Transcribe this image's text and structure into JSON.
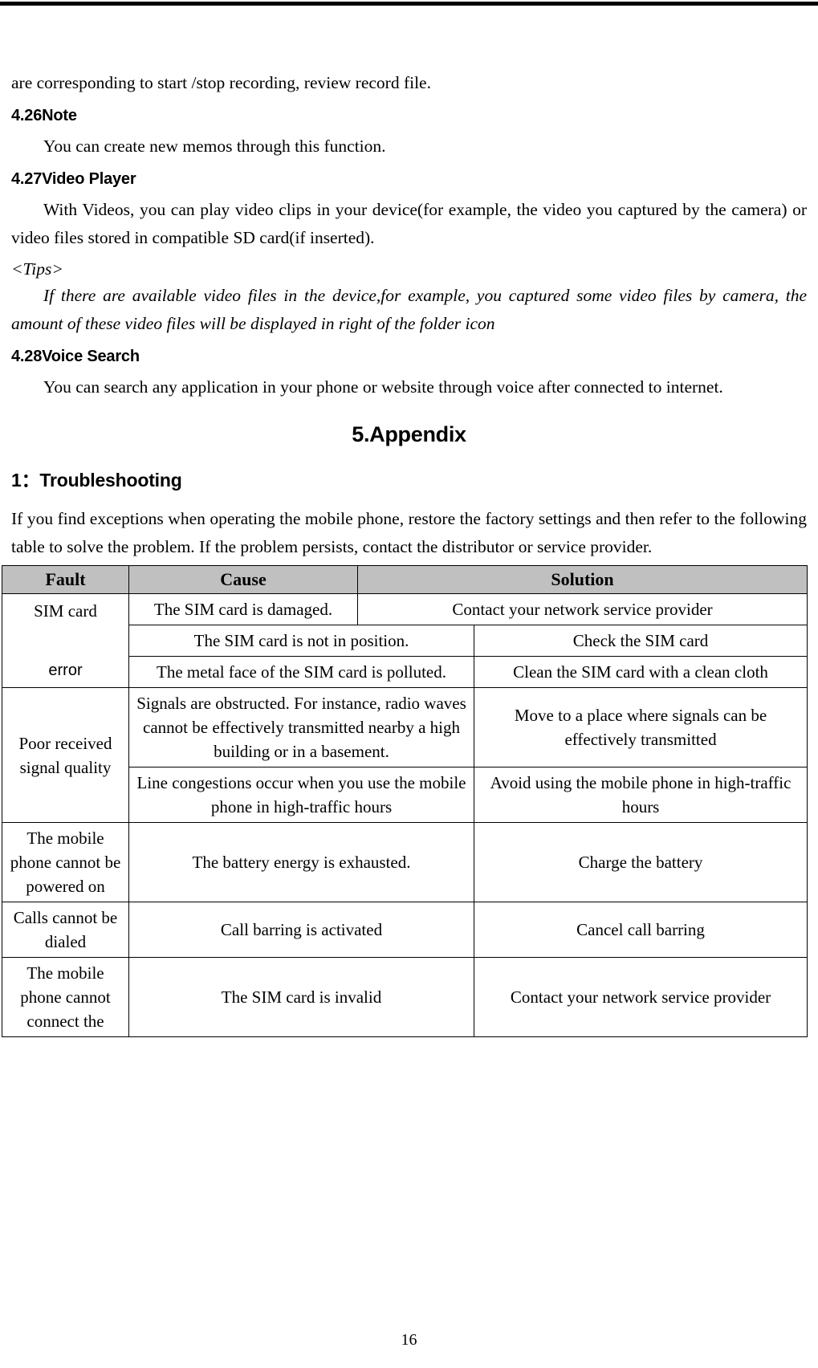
{
  "document": {
    "page_number": "16",
    "header_rule": true
  },
  "intro": {
    "continuation_line": "are corresponding to start /stop recording, review record file."
  },
  "sections": [
    {
      "heading": "4.26Note",
      "paragraphs": [
        "You can create new memos through this function."
      ]
    },
    {
      "heading": "4.27Video Player",
      "paragraphs": [
        "With Videos, you can play video clips in your device(for example, the video you captured by the camera) or video files stored in compatible SD card(if inserted)."
      ],
      "tips_label": "<Tips>",
      "tips_text": "If there are available video files in the device,for example, you captured some video files by camera, the amount of these video files will be displayed in right of the folder icon"
    },
    {
      "heading": "4.28Voice Search",
      "paragraphs": [
        "You can search any application in your phone or website through voice after connected to internet."
      ]
    }
  ],
  "appendix": {
    "chapter_title": "5.Appendix",
    "section_title": "1：Troubleshooting",
    "intro": "If you find exceptions when operating the mobile phone, restore the factory settings and then refer to the following table to solve the problem. If the problem persists, contact the distributor or service provider."
  },
  "table": {
    "header_bg": "#c0c0c0",
    "columns": [
      "Fault",
      "Cause",
      "Solution"
    ],
    "rows": [
      {
        "fault_primary": "SIM card",
        "fault_secondary": "error",
        "causes": [
          "The SIM card is damaged.",
          "The SIM card is not in position.",
          "The metal face of the SIM card is polluted."
        ],
        "solutions": [
          "Contact your network service provider",
          "Check the SIM card",
          "Clean the SIM card with a clean cloth"
        ]
      },
      {
        "fault": "Poor received signal quality",
        "causes": [
          "Signals are obstructed. For instance, radio waves cannot be effectively transmitted nearby a high building or in a basement.",
          "Line congestions occur when you use the mobile phone in high-traffic hours"
        ],
        "solutions": [
          "Move to a place where signals can be effectively transmitted",
          "Avoid using the mobile phone in high-traffic hours"
        ]
      },
      {
        "fault": "The mobile phone cannot be powered on",
        "causes": [
          "The battery energy is exhausted."
        ],
        "solutions": [
          "Charge the battery"
        ]
      },
      {
        "fault": "Calls cannot be dialed",
        "causes": [
          "Call barring is activated"
        ],
        "solutions": [
          "Cancel call barring"
        ]
      },
      {
        "fault": "The mobile phone cannot connect the",
        "causes": [
          "The SIM card is invalid"
        ],
        "solutions": [
          "Contact your network service provider"
        ]
      }
    ]
  }
}
